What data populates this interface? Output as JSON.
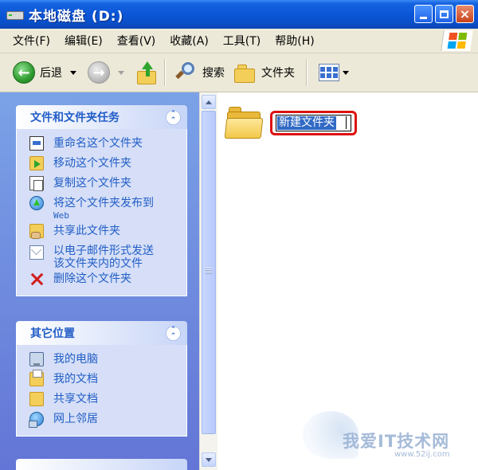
{
  "window": {
    "title": "本地磁盘 (D:)",
    "icon": "drive-icon",
    "buttons": {
      "minimize": "minimize-icon",
      "maximize": "maximize-icon",
      "close": "×"
    }
  },
  "menu": {
    "items": [
      "文件(F)",
      "编辑(E)",
      "查看(V)",
      "收藏(A)",
      "工具(T)",
      "帮助(H)"
    ]
  },
  "toolbar": {
    "back_label": "后退",
    "search_label": "搜索",
    "folders_label": "文件夹"
  },
  "task_panels": [
    {
      "title": "文件和文件夹任务",
      "tasks": [
        {
          "icon": "rename-icon",
          "label": "重命名这个文件夹"
        },
        {
          "icon": "move-icon",
          "label": "移动这个文件夹"
        },
        {
          "icon": "copy-icon",
          "label": "复制这个文件夹"
        },
        {
          "icon": "publish-web-icon",
          "label": "将这个文件夹发布到",
          "label2": "Web"
        },
        {
          "icon": "share-folder-icon",
          "label": "共享此文件夹"
        },
        {
          "icon": "email-icon",
          "label": "以电子邮件形式发送",
          "label2": "该文件夹内的文件"
        },
        {
          "icon": "delete-icon",
          "label": "删除这个文件夹"
        }
      ]
    },
    {
      "title": "其它位置",
      "places": [
        {
          "icon": "my-computer-icon",
          "label": "我的电脑"
        },
        {
          "icon": "my-documents-icon",
          "label": "我的文档"
        },
        {
          "icon": "shared-documents-icon",
          "label": "共享文档"
        },
        {
          "icon": "network-places-icon",
          "label": "网上邻居"
        }
      ]
    }
  ],
  "content": {
    "folder_name_editing": "新建文件夹"
  },
  "watermark": {
    "text": "我爱IT技术网",
    "url": "www.52ij.com"
  },
  "colors": {
    "titlebar": "#0a56d8",
    "taskpane_bg": "#7ba2e7",
    "panel_title": "#215dc6",
    "selection": "#316ac5",
    "highlight_border": "#d11111"
  }
}
